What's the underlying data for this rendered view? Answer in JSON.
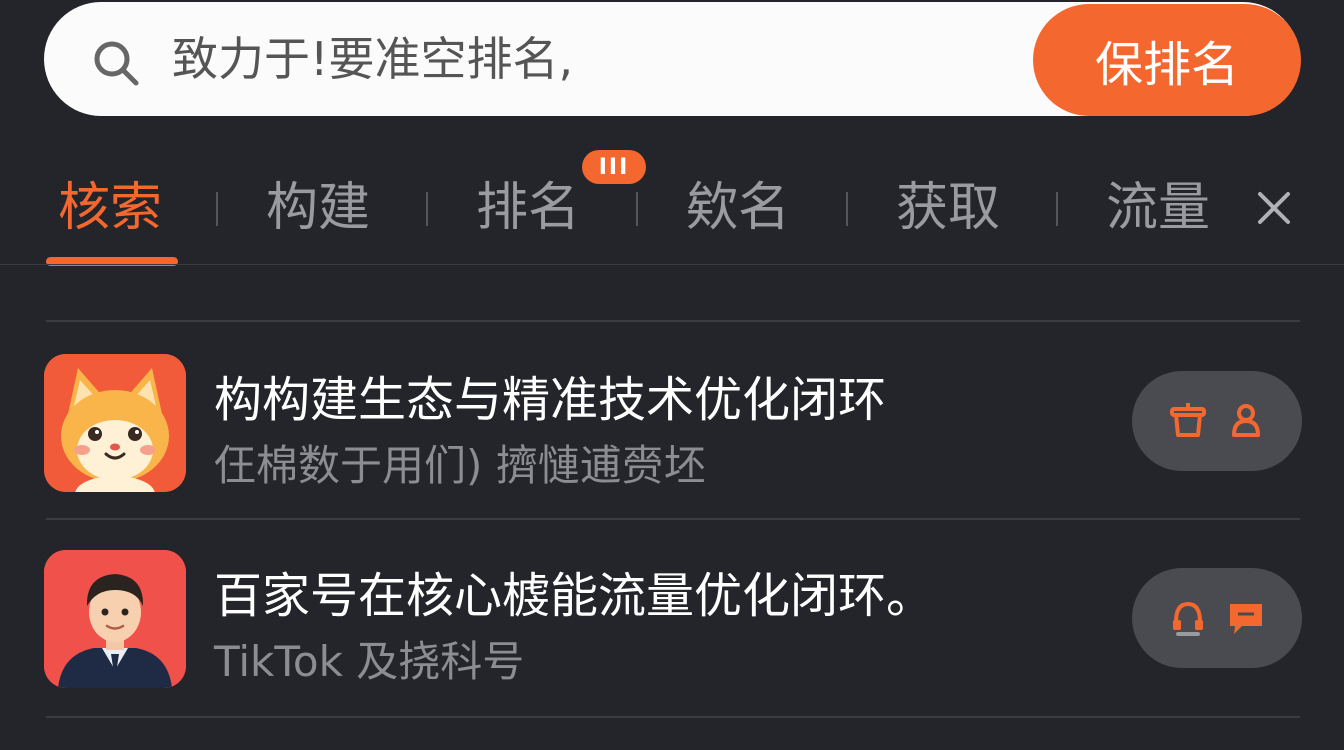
{
  "search": {
    "value": "致力于!要准空排名,",
    "button_label": "保排名"
  },
  "tabs": {
    "items": [
      {
        "label": "核索",
        "active": true
      },
      {
        "label": "构建",
        "active": false
      },
      {
        "label": "排名",
        "active": false
      },
      {
        "label": "欸名",
        "active": false
      },
      {
        "label": "获取",
        "active": false
      },
      {
        "label": "流量",
        "active": false
      }
    ],
    "badge": "III",
    "close_icon": "close-icon"
  },
  "list": {
    "items": [
      {
        "title": "构构建生态与精准技术优化闭环",
        "subtitle": "仼棉数于用们) 擠慩逋赍坯",
        "avatar": "cat-mascot-avatar",
        "actions": [
          "cup-icon",
          "bell-icon"
        ]
      },
      {
        "title": "百家号在核心榩能流量优化闭环。",
        "subtitle": "TikTok 及挠科号",
        "avatar": "man-portrait-avatar",
        "actions": [
          "headset-icon",
          "chat-bubble-icon"
        ]
      }
    ]
  },
  "colors": {
    "accent": "#f4682f",
    "background": "#24252a",
    "pill": "#4a4b50"
  }
}
